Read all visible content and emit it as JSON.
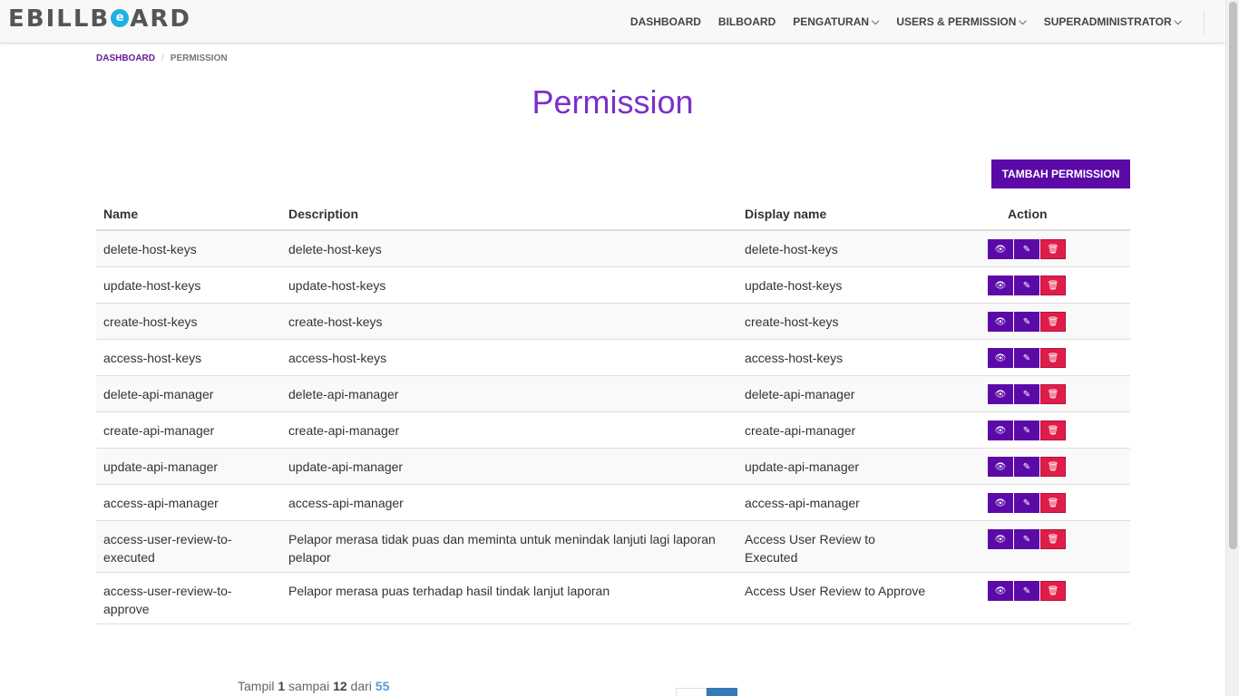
{
  "brand": {
    "logo_left": "EBILLB",
    "logo_o": "e",
    "logo_right": "ARD"
  },
  "nav": [
    {
      "label": "DASHBOARD",
      "dropdown": false
    },
    {
      "label": "BILBOARD",
      "dropdown": false
    },
    {
      "label": "PENGATURAN",
      "dropdown": true
    },
    {
      "label": "USERS & PERMISSION",
      "dropdown": true
    },
    {
      "label": "SUPERADMINISTRATOR",
      "dropdown": true
    }
  ],
  "breadcrumb": {
    "home": "DASHBOARD",
    "separator": "/",
    "current": "PERMISSION"
  },
  "page": {
    "title": "Permission",
    "add_button": "TAMBAH PERMISSION"
  },
  "table": {
    "headers": {
      "name": "Name",
      "description": "Description",
      "display_name": "Display name",
      "action": "Action"
    },
    "rows": [
      {
        "name": "delete-host-keys",
        "description": "delete-host-keys",
        "display_name": "delete-host-keys"
      },
      {
        "name": "update-host-keys",
        "description": "update-host-keys",
        "display_name": "update-host-keys"
      },
      {
        "name": "create-host-keys",
        "description": "create-host-keys",
        "display_name": "create-host-keys"
      },
      {
        "name": "access-host-keys",
        "description": "access-host-keys",
        "display_name": "access-host-keys"
      },
      {
        "name": "delete-api-manager",
        "description": "delete-api-manager",
        "display_name": "delete-api-manager"
      },
      {
        "name": "create-api-manager",
        "description": "create-api-manager",
        "display_name": "create-api-manager"
      },
      {
        "name": "update-api-manager",
        "description": "update-api-manager",
        "display_name": "update-api-manager"
      },
      {
        "name": "access-api-manager",
        "description": "access-api-manager",
        "display_name": "access-api-manager"
      },
      {
        "name": "access-user-review-to-executed",
        "description": "Pelapor merasa tidak puas dan meminta untuk menindak lanjuti lagi laporan pelapor",
        "display_name": "Access User Review to Executed"
      },
      {
        "name": "access-user-review-to-approve",
        "description": "Pelapor merasa puas terhadap hasil tindak lanjut laporan",
        "display_name": "Access User Review to Approve"
      }
    ]
  },
  "pagination": {
    "prefix": "Tampil",
    "from": "1",
    "mid": "sampai",
    "to": "12",
    "of_label": "dari",
    "total": "55"
  },
  "colors": {
    "brand_purple": "#5b0aa8",
    "title_purple": "#7b30c8",
    "danger": "#e01d48",
    "logo_accent": "#1fb0e3"
  },
  "icons": {
    "view": "eye-icon",
    "edit": "pencil-icon",
    "delete": "trash-icon",
    "dropdown": "chevron-down-icon"
  }
}
